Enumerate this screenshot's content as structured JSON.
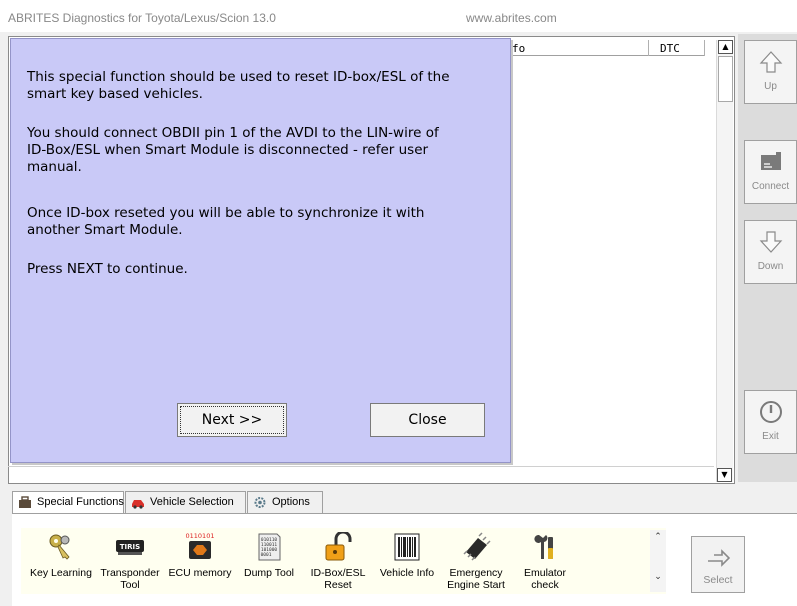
{
  "window": {
    "title": "ABRITES Diagnostics for Toyota/Lexus/Scion 13.0",
    "website": "www.abrites.com"
  },
  "list": {
    "columns": [
      "fo",
      "DTC"
    ]
  },
  "nav": {
    "up": "Up",
    "connect": "Connect",
    "down": "Down",
    "exit": "Exit"
  },
  "dialog": {
    "paragraphs": [
      [
        "This special function should be used to reset ID-box/ESL of the",
        "smart key based vehicles."
      ],
      [
        "You should connect OBDII pin 1 of the AVDI to the LIN-wire of",
        "ID-Box/ESL when Smart Module is disconnected - refer user",
        "manual."
      ],
      [
        "Once ID-box reseted you will be able to synchronize it with",
        "another Smart Module."
      ],
      [
        "Press NEXT to continue."
      ]
    ],
    "next_button": "Next >>",
    "close_button": "Close"
  },
  "tabs": [
    "Special Functions",
    "Vehicle Selection",
    "Options"
  ],
  "functions": [
    {
      "line1": "Key Learning",
      "line2": "",
      "icon": "keys-icon"
    },
    {
      "line1": "Transponder",
      "line2": "Tool",
      "icon": "transponder-icon"
    },
    {
      "line1": "ECU memory",
      "line2": "",
      "icon": "ecu-memory-icon"
    },
    {
      "line1": "Dump Tool",
      "line2": "",
      "icon": "dump-tool-icon"
    },
    {
      "line1": "ID-Box/ESL",
      "line2": "Reset",
      "icon": "padlock-icon"
    },
    {
      "line1": "Vehicle Info",
      "line2": "",
      "icon": "barcode-icon"
    },
    {
      "line1": "Emergency",
      "line2": "Engine Start",
      "icon": "chip-icon"
    },
    {
      "line1": "Emulator",
      "line2": "check",
      "icon": "tools-icon"
    }
  ],
  "ecu_icon_text": "0110101",
  "transponder_icon_text": "TIRIS",
  "dump_icon_text": [
    "010110",
    "110011",
    "101000",
    "0001"
  ],
  "select_button": "Select",
  "colors": {
    "dialog_bg": "#c9c9f7",
    "function_strip_bg": "#fffff0",
    "nav_bg": "#dcdcdc"
  }
}
